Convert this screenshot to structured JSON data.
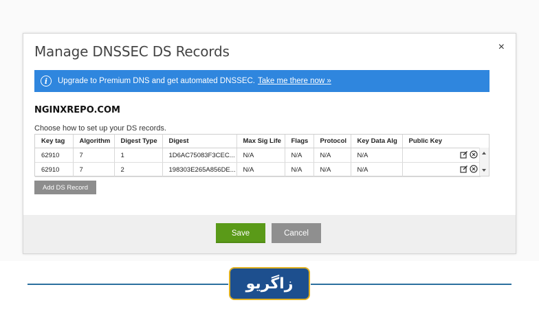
{
  "modal": {
    "title": "Manage DNSSEC DS Records",
    "close_label": "×"
  },
  "banner": {
    "text": "Upgrade to Premium DNS and get automated DNSSEC.",
    "link": "Take me there now »",
    "icon": "info-icon"
  },
  "domain": "NGINXREPO.COM",
  "instructions": "Choose how to set up your DS records.",
  "table": {
    "headers": [
      "Key tag",
      "Algorithm",
      "Digest Type",
      "Digest",
      "Max Sig Life",
      "Flags",
      "Protocol",
      "Key Data Alg",
      "Public Key"
    ],
    "rows": [
      [
        "62910",
        "7",
        "1",
        "1D6AC75083F3CEC...",
        "N/A",
        "N/A",
        "N/A",
        "N/A",
        ""
      ],
      [
        "62910",
        "7",
        "2",
        "198303E265A856DE...",
        "N/A",
        "N/A",
        "N/A",
        "N/A",
        ""
      ]
    ]
  },
  "buttons": {
    "add_record": "Add DS Record",
    "save": "Save",
    "cancel": "Cancel"
  },
  "branding": {
    "logo_text": "زاگریو"
  },
  "colors": {
    "banner": "#2f86de",
    "save": "#5a9a18",
    "cancel": "#8f8f8f",
    "logo_bg": "#1d4f8e"
  }
}
